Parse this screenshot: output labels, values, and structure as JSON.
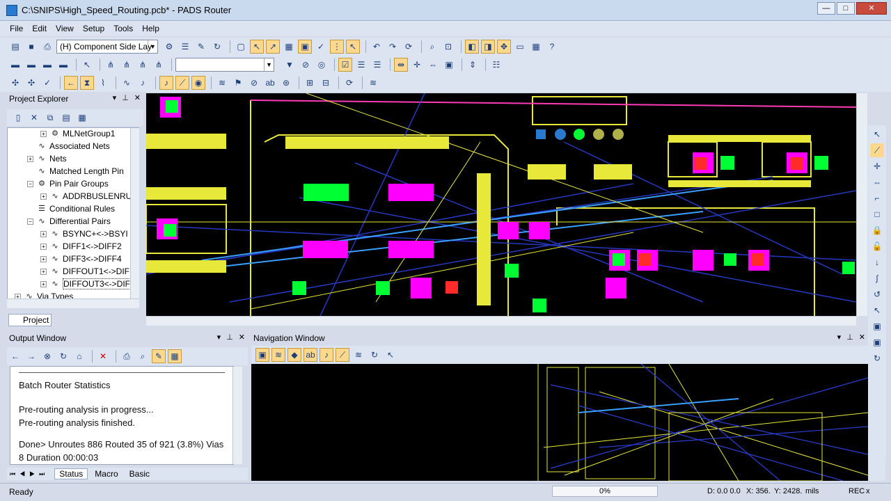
{
  "window": {
    "title": "C:\\SNIPS\\High_Speed_Routing.pcb* - PADS Router",
    "min_icon": "—",
    "max_icon": "□",
    "close_icon": "✕"
  },
  "menu": [
    "File",
    "Edit",
    "View",
    "Setup",
    "Tools",
    "Help"
  ],
  "toolbar1": {
    "layer_combo": "(H) Component Side Lay",
    "icons": [
      "open-icon",
      "save-icon",
      "print-icon",
      "layer-settings-icon",
      "list-icon",
      "pen-icon",
      "refresh-icon",
      "blank-icon",
      "select-icon",
      "drc-icon",
      "grid-icon",
      "route-icon",
      "check-icon",
      "autoroute-icon",
      "cursor-icon",
      "undo-icon",
      "redo-icon",
      "reload-icon",
      "zoom-icon",
      "zoom-window-icon",
      "view1-icon",
      "view2-icon",
      "pan-icon",
      "board-icon",
      "help-icon"
    ]
  },
  "toolbar2": {
    "empty_combo": ""
  },
  "project_explorer": {
    "title": "Project Explorer",
    "tree": [
      {
        "label": "MLNetGroup1",
        "level": 3,
        "exp": "+"
      },
      {
        "label": "Associated Nets",
        "level": 2,
        "exp": ""
      },
      {
        "label": "Nets",
        "level": 2,
        "exp": "+"
      },
      {
        "label": "Matched Length Pin",
        "level": 2,
        "exp": ""
      },
      {
        "label": "Pin Pair Groups",
        "level": 2,
        "exp": "−"
      },
      {
        "label": "ADDRBUSLENRU",
        "level": 3,
        "exp": "+"
      },
      {
        "label": "Conditional Rules",
        "level": 2,
        "exp": ""
      },
      {
        "label": "Differential Pairs",
        "level": 2,
        "exp": "−"
      },
      {
        "label": "BSYNC+<->BSYI",
        "level": 3,
        "exp": "+"
      },
      {
        "label": "DIFF1<->DIFF2",
        "level": 3,
        "exp": "+"
      },
      {
        "label": "DIFF3<->DIFF4",
        "level": 3,
        "exp": "+"
      },
      {
        "label": "DIFFOUT1<->DIF",
        "level": 3,
        "exp": "+"
      },
      {
        "label": "DIFFOUT3<->DIF",
        "level": 3,
        "exp": "+"
      },
      {
        "label": "Via Types",
        "level": 1,
        "exp": "+"
      }
    ],
    "tab": "Project"
  },
  "output_window": {
    "title": "Output Window",
    "lines": [
      "Batch Router Statistics",
      "",
      "Pre-routing analysis in progress...",
      "Pre-routing analysis finished.",
      "",
      "Done> Unroutes 886 Routed 35 of 921 (3.8%) Vias",
      "8 Duration 00:00:03"
    ],
    "tabs": [
      "Status",
      "Macro",
      "Basic"
    ]
  },
  "navigation_window": {
    "title": "Navigation Window"
  },
  "status": {
    "text": "Ready",
    "progress": "0%",
    "coords": "D: 0.0 0.0",
    "x": "X: 356.",
    "y": "Y: 2428.",
    "units": "mils",
    "rec": "REC",
    "x_icon": "x"
  },
  "colors": {
    "accent_toolbar": "#fbd88d",
    "pcb_bg": "#000000",
    "trace_yellow": "#e8e83a",
    "pad_magenta": "#ff00ff",
    "pad_green": "#00ff33",
    "trace_blue": "#2a3fd6"
  }
}
